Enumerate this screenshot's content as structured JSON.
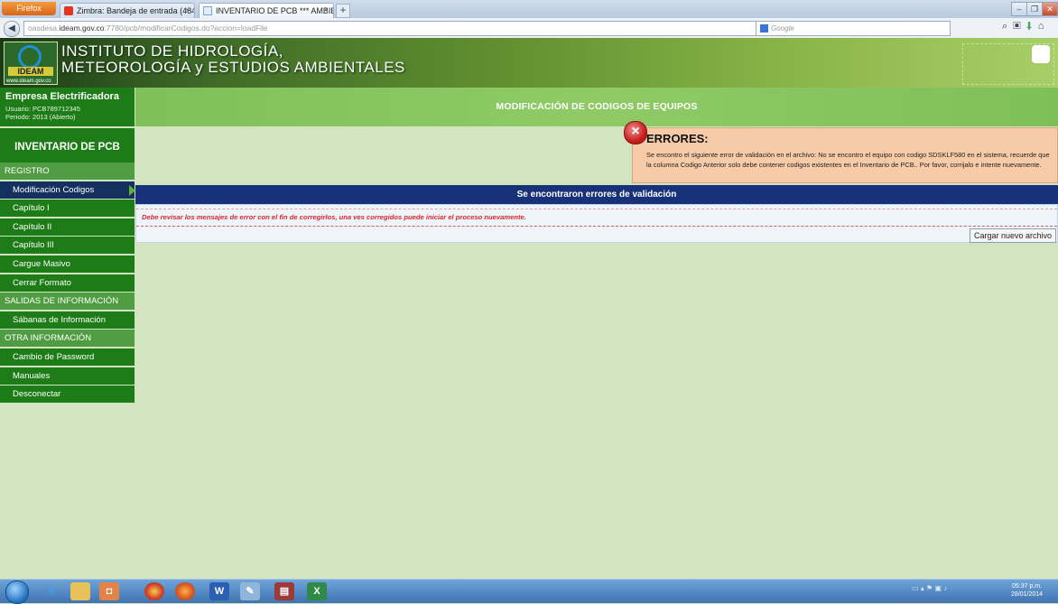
{
  "browser": {
    "menu_button": "Firefox",
    "tabs": [
      {
        "label": "Zimbra: Bandeja de entrada (484)",
        "close": "×"
      },
      {
        "label": "INVENTARIO DE PCB *** AMBIENTE ...",
        "close": "×"
      }
    ],
    "new_tab": "+",
    "url_host_prefix": "oasdesa.",
    "url_host": "ideam.gov.co",
    "url_rest": ":7780/pcb/modificarCodigos.do?accion=loadFile",
    "search_placeholder": "Google",
    "back": "◀"
  },
  "banner": {
    "line1": "INSTITUTO DE HIDROLOGÍA,",
    "line2": "METEOROLOGÍA y ESTUDIOS AMBIENTALES",
    "logo_text": "IDEAM",
    "logo_url": "www.ideam.gov.co"
  },
  "sidebar": {
    "company": "Empresa Electrificadora",
    "user": "Usuario: PCB789712345",
    "period": "Periodo: 2013 (Abierto)",
    "title": "INVENTARIO DE PCB",
    "menu": [
      {
        "label": "REGISTRO",
        "kind": "section"
      },
      {
        "label": "Modificación Codigos",
        "kind": "active"
      },
      {
        "label": "Capítulo I",
        "kind": "item"
      },
      {
        "label": "Capítulo II",
        "kind": "item"
      },
      {
        "label": "Capítulo III",
        "kind": "item"
      },
      {
        "label": "Cargue Masivo",
        "kind": "item"
      },
      {
        "label": "Cerrar Formato",
        "kind": "item"
      },
      {
        "label": "SALIDAS DE INFORMACIÓN",
        "kind": "section"
      },
      {
        "label": "Sábanas de Información",
        "kind": "item"
      },
      {
        "label": "OTRA INFORMACIÓN",
        "kind": "section"
      },
      {
        "label": "Cambio de Password",
        "kind": "item"
      },
      {
        "label": "Manuales",
        "kind": "item"
      },
      {
        "label": "Desconectar",
        "kind": "item"
      }
    ]
  },
  "main": {
    "page_title": "MODIFICACIÓN DE CODIGOS DE EQUIPOS",
    "error_title": "ERRORES:",
    "error_message": "Se encontro el siguiente error de validación en el archivo: No se encontro el equipo con codigo SDSKLF580 en el sistema, recuerde que la columna Codigo Anterior solo debe contener codigos existentes en el Inventario de PCB.. Por favor, corrijalo e intente nuevamente.",
    "validation_header": "Se encontraron errores de validación",
    "warning": "Debe revisar los mensajes de error con el fin de corregirlos, una ves corregidos puede iniciar el proceso nuevamente.",
    "reload_button": "Cargar nuevo archivo"
  },
  "taskbar": {
    "time": "05:37 p.m.",
    "date": "28/01/2014"
  },
  "colors": {
    "sidebar_green": "#1e7c18",
    "section_green": "#4f9c42",
    "active_blue": "#14305e",
    "header_blue": "#18327a",
    "error_bg": "#f7cba7",
    "warning_red": "#e0242b"
  }
}
